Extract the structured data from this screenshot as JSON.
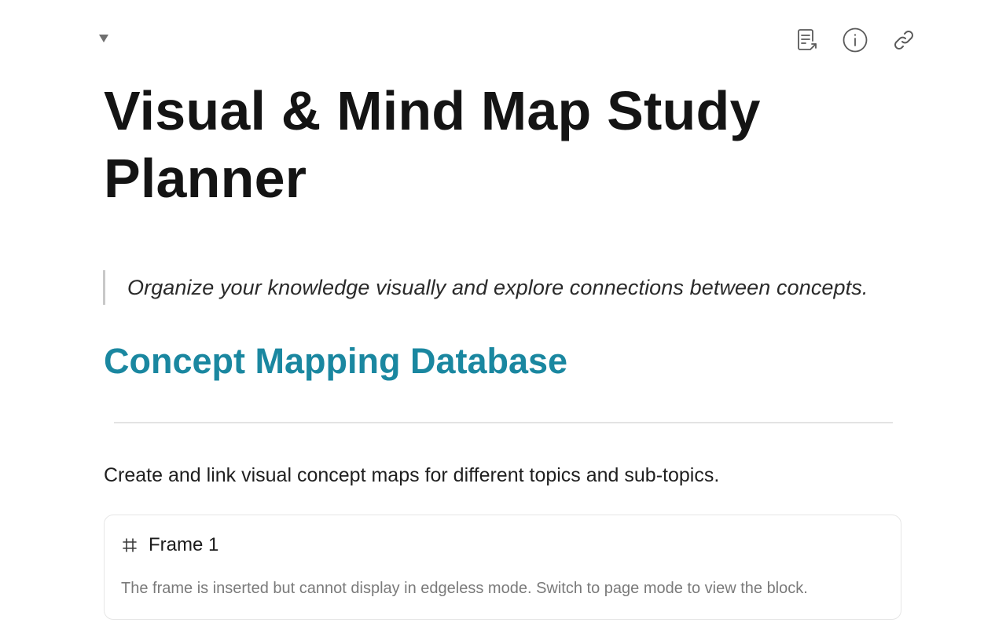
{
  "toolbar": {
    "icons": [
      "page-export-icon",
      "info-icon",
      "link-icon"
    ]
  },
  "document": {
    "title": "Visual & Mind Map Study Planner",
    "quote": "Organize your knowledge visually and explore connections between concepts.",
    "heading": "Concept Mapping Database",
    "paragraph": "Create and link visual concept maps for different topics and sub-topics."
  },
  "frame_block": {
    "icon": "frame-hash-icon",
    "title": "Frame 1",
    "note": "The frame is inserted but cannot display in edgeless mode. Switch to page mode to view the block."
  },
  "colors": {
    "heading_accent": "#1a87a0",
    "title_text": "#141414",
    "muted_text": "#7a7a7a",
    "quote_bar": "#c8c8c8"
  }
}
